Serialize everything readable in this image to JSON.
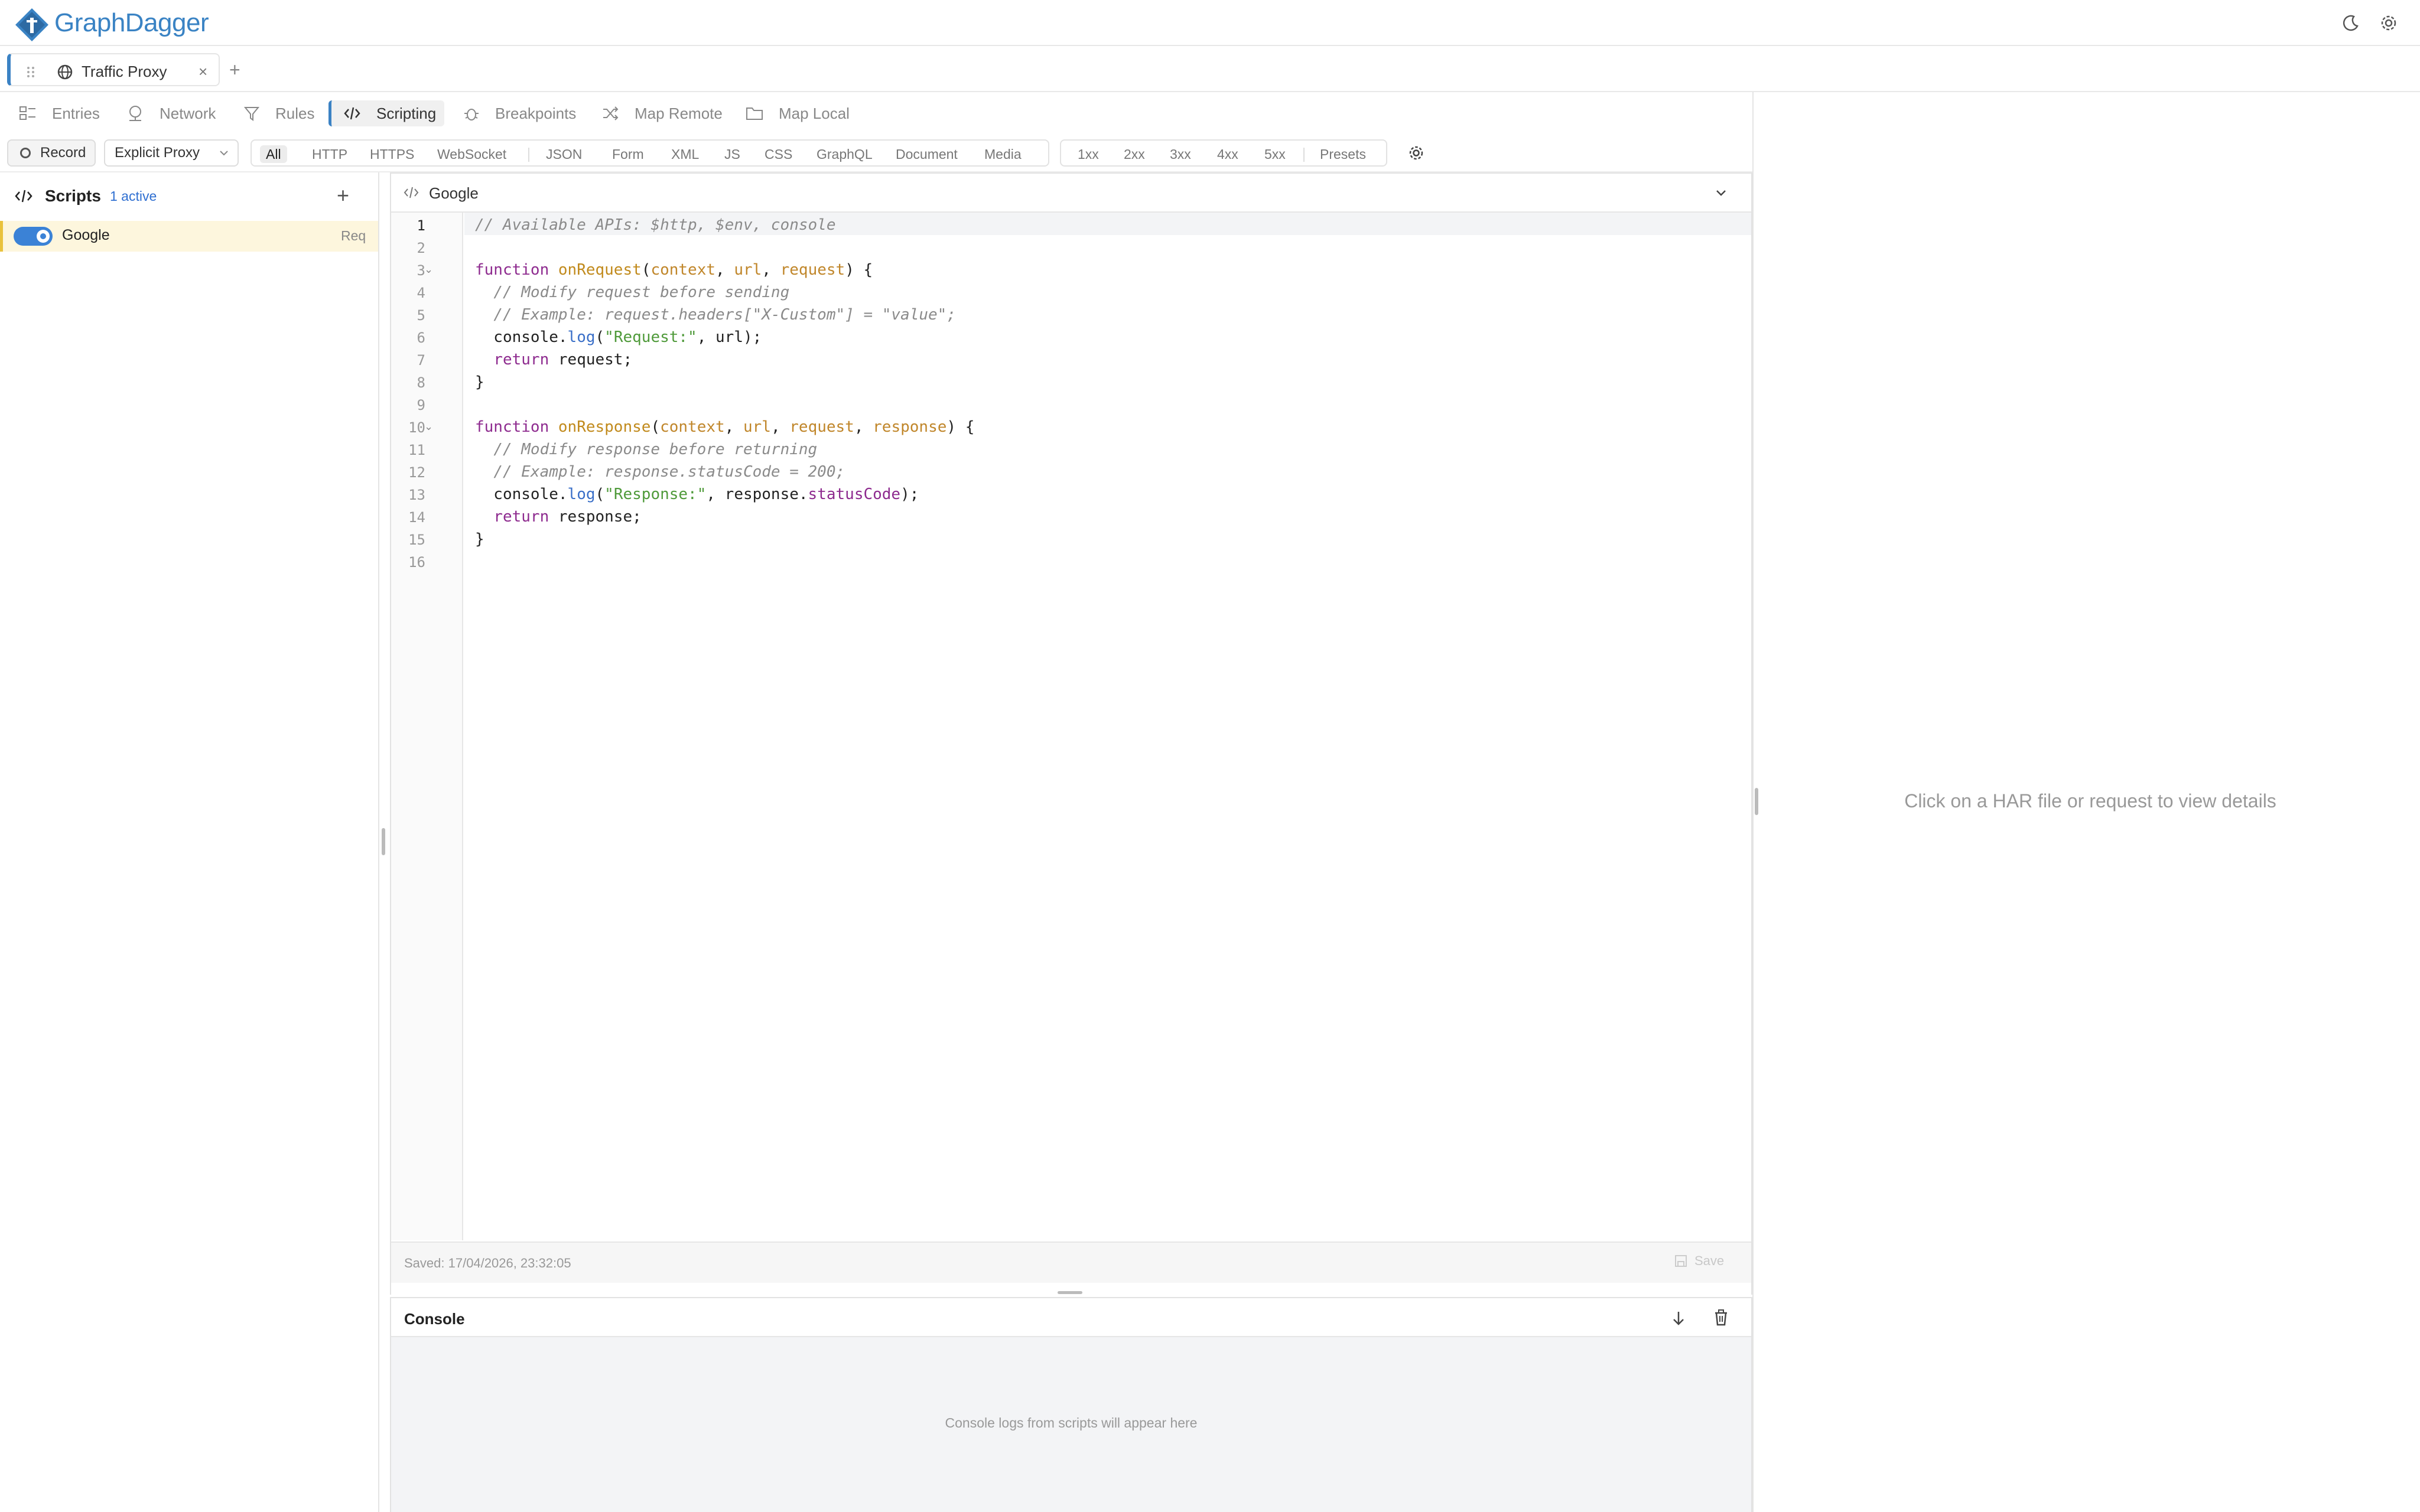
{
  "app": {
    "name": "GraphDagger"
  },
  "tabs": [
    {
      "label": "Traffic Proxy",
      "close": "×"
    }
  ],
  "new_tab": "+",
  "nav": {
    "items": [
      {
        "label": "Entries",
        "icon": "entries-icon"
      },
      {
        "label": "Network",
        "icon": "network-icon"
      },
      {
        "label": "Rules",
        "icon": "filter-icon"
      },
      {
        "label": "Scripting",
        "icon": "code-icon",
        "active": true
      },
      {
        "label": "Breakpoints",
        "icon": "bug-icon"
      },
      {
        "label": "Map Remote",
        "icon": "shuffle-icon"
      },
      {
        "label": "Map Local",
        "icon": "folder-icon"
      }
    ]
  },
  "filterbar": {
    "record": "Record",
    "proxy_mode": "Explicit Proxy",
    "types": [
      "All",
      "HTTP",
      "HTTPS",
      "WebSocket",
      "JSON",
      "Form",
      "XML",
      "JS",
      "CSS",
      "GraphQL",
      "Document",
      "Media"
    ],
    "active_type": "All",
    "statuses": [
      "1xx",
      "2xx",
      "3xx",
      "4xx",
      "5xx",
      "Presets"
    ]
  },
  "sidebar": {
    "title": "Scripts",
    "active_count": "1 active",
    "add": "+",
    "scripts": [
      {
        "name": "Google",
        "badge": "Req",
        "enabled": true
      }
    ]
  },
  "editor": {
    "title": "Google",
    "current_line": 1,
    "line_numbers": [
      "1",
      "2",
      "3",
      "4",
      "5",
      "6",
      "7",
      "8",
      "9",
      "10",
      "11",
      "12",
      "13",
      "14",
      "15",
      "16"
    ],
    "code_lines": [
      "// Available APIs: $http, $env, console",
      "",
      "function onRequest(context, url, request) {",
      "  // Modify request before sending",
      "  // Example: request.headers[\"X-Custom\"] = \"value\";",
      "  console.log(\"Request:\", url);",
      "  return request;",
      "}",
      "",
      "function onResponse(context, url, request, response) {",
      "  // Modify response before returning",
      "  // Example: response.statusCode = 200;",
      "  console.log(\"Response:\", response.statusCode);",
      "  return response;",
      "}",
      ""
    ],
    "saved": "Saved: 17/04/2026, 23:32:05",
    "save": "Save"
  },
  "console": {
    "title": "Console",
    "empty": "Console logs from scripts will appear here"
  },
  "details": {
    "empty": "Click on a HAR file or request to view details"
  },
  "colors": {
    "accent": "#3b82d6",
    "brand": "#3a83c4",
    "selected_row": "#fdf6dd"
  }
}
